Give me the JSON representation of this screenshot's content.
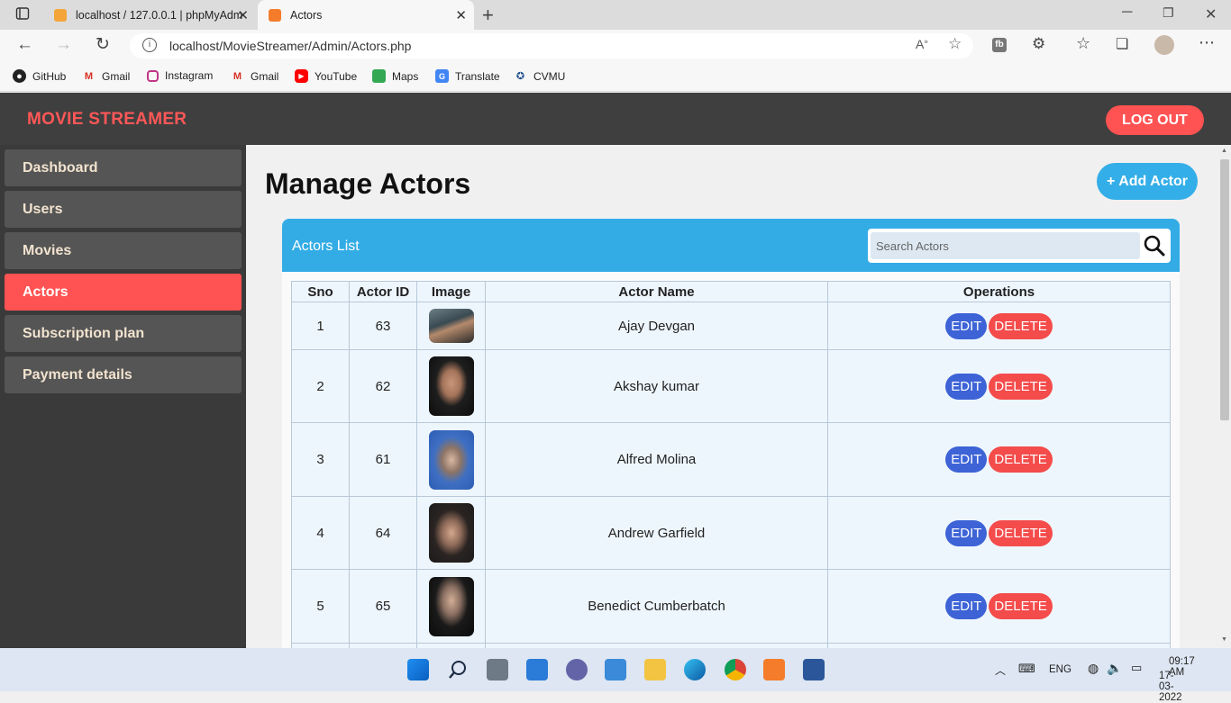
{
  "browser": {
    "tabs": [
      {
        "title": "localhost / 127.0.0.1 | phpMyAdm",
        "favicon": "phpmyadmin-icon"
      },
      {
        "title": "Actors",
        "favicon": "xampp-icon"
      }
    ],
    "url": "localhost/MovieStreamer/Admin/Actors.php",
    "bookmarks": [
      {
        "label": "GitHub",
        "icon": "github-icon"
      },
      {
        "label": "Gmail",
        "icon": "gmail-icon"
      },
      {
        "label": "Instagram",
        "icon": "instagram-icon"
      },
      {
        "label": "Gmail",
        "icon": "gmail-icon"
      },
      {
        "label": "YouTube",
        "icon": "youtube-icon"
      },
      {
        "label": "Maps",
        "icon": "maps-icon"
      },
      {
        "label": "Translate",
        "icon": "translate-icon"
      },
      {
        "label": "CVMU",
        "icon": "cvmu-icon"
      }
    ]
  },
  "header": {
    "brand": "MOVIE STREAMER",
    "logout_label": "LOG OUT"
  },
  "sidebar": {
    "items": [
      {
        "label": "Dashboard",
        "active": false
      },
      {
        "label": "Users",
        "active": false
      },
      {
        "label": "Movies",
        "active": false
      },
      {
        "label": "Actors",
        "active": true
      },
      {
        "label": "Subscription plan",
        "active": false
      },
      {
        "label": "Payment details",
        "active": false
      }
    ]
  },
  "main": {
    "title": "Manage Actors",
    "add_button": "+ Add Actor",
    "card_title": "Actors List",
    "search_placeholder": "Search Actors",
    "columns": [
      "Sno",
      "Actor ID",
      "Image",
      "Actor Name",
      "Operations"
    ],
    "rows": [
      {
        "sno": "1",
        "id": "63",
        "name": "Ajay Devgan"
      },
      {
        "sno": "2",
        "id": "62",
        "name": "Akshay kumar"
      },
      {
        "sno": "3",
        "id": "61",
        "name": "Alfred Molina"
      },
      {
        "sno": "4",
        "id": "64",
        "name": "Andrew Garfield"
      },
      {
        "sno": "5",
        "id": "65",
        "name": "Benedict Cumberbatch"
      }
    ],
    "edit_label": "EDIT",
    "delete_label": "DELETE"
  },
  "taskbar": {
    "language": "ENG",
    "time": "09:17 AM",
    "date": "17-03-2022"
  },
  "colors": {
    "accent_red": "#ff5252",
    "accent_blue": "#34aee8",
    "edit_blue": "#3d63d6",
    "header_dark": "#3f3f3f"
  }
}
